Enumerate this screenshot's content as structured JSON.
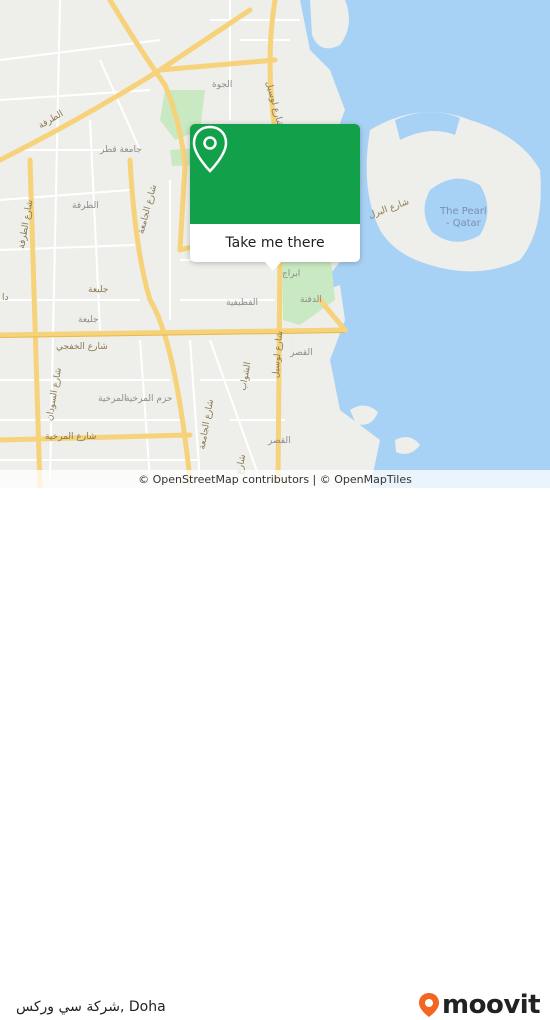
{
  "map": {
    "popup": {
      "button_label": "Take me there",
      "icon": "location-pin-icon",
      "header_color": "#13a04a"
    },
    "colors": {
      "water": "#a8d2f5",
      "land": "#eeeeea",
      "park": "#c9e9c2",
      "primary_road": "#f6d27a",
      "street": "#ffffff"
    },
    "labels": {
      "al_hawa": "الجوة",
      "al_tarfa_road": "الطرفة",
      "qatar_university": "جامعة قطر",
      "al_jamaa_street_north": "شارع الجامعة",
      "al_tarfa_area": "الطرفة",
      "jelaiah_road": "جليعة",
      "jelaiah_area": "جليعة",
      "al_khafji_street": "شارع الخفجي",
      "al_soudan_street": "شارع السودان",
      "al_markhiya_area": "حزم المرخية",
      "al_markhiya_dist": "المرخية",
      "al_markhiya_street": "شارع المرخية",
      "al_jamaa_street_south": "شارع الجامعة",
      "lusail_street_north": "شارع لوسيل",
      "lusail_street_south": "شارع لوسيل",
      "al_qasr": "القصر",
      "al_qasr_south": "القصر",
      "al_dafna": "الدفنة",
      "al_khulaifat": "القطيفية",
      "west_bay": "ابراج",
      "pearl_street": "شارع البرل",
      "the_pearl": "The Pearl\n- Qatar",
      "al_shawab": "الشواب",
      "al_tarfa_road_left": "شارع الطرفة",
      "shamal": "شارع",
      "d_label": "دا"
    },
    "attribution": "© OpenStreetMap contributors | © OpenMapTiles"
  },
  "footer": {
    "place_name": "شركة سي وركس, Doha",
    "brand": "moovit",
    "brand_color": "#f26522"
  }
}
